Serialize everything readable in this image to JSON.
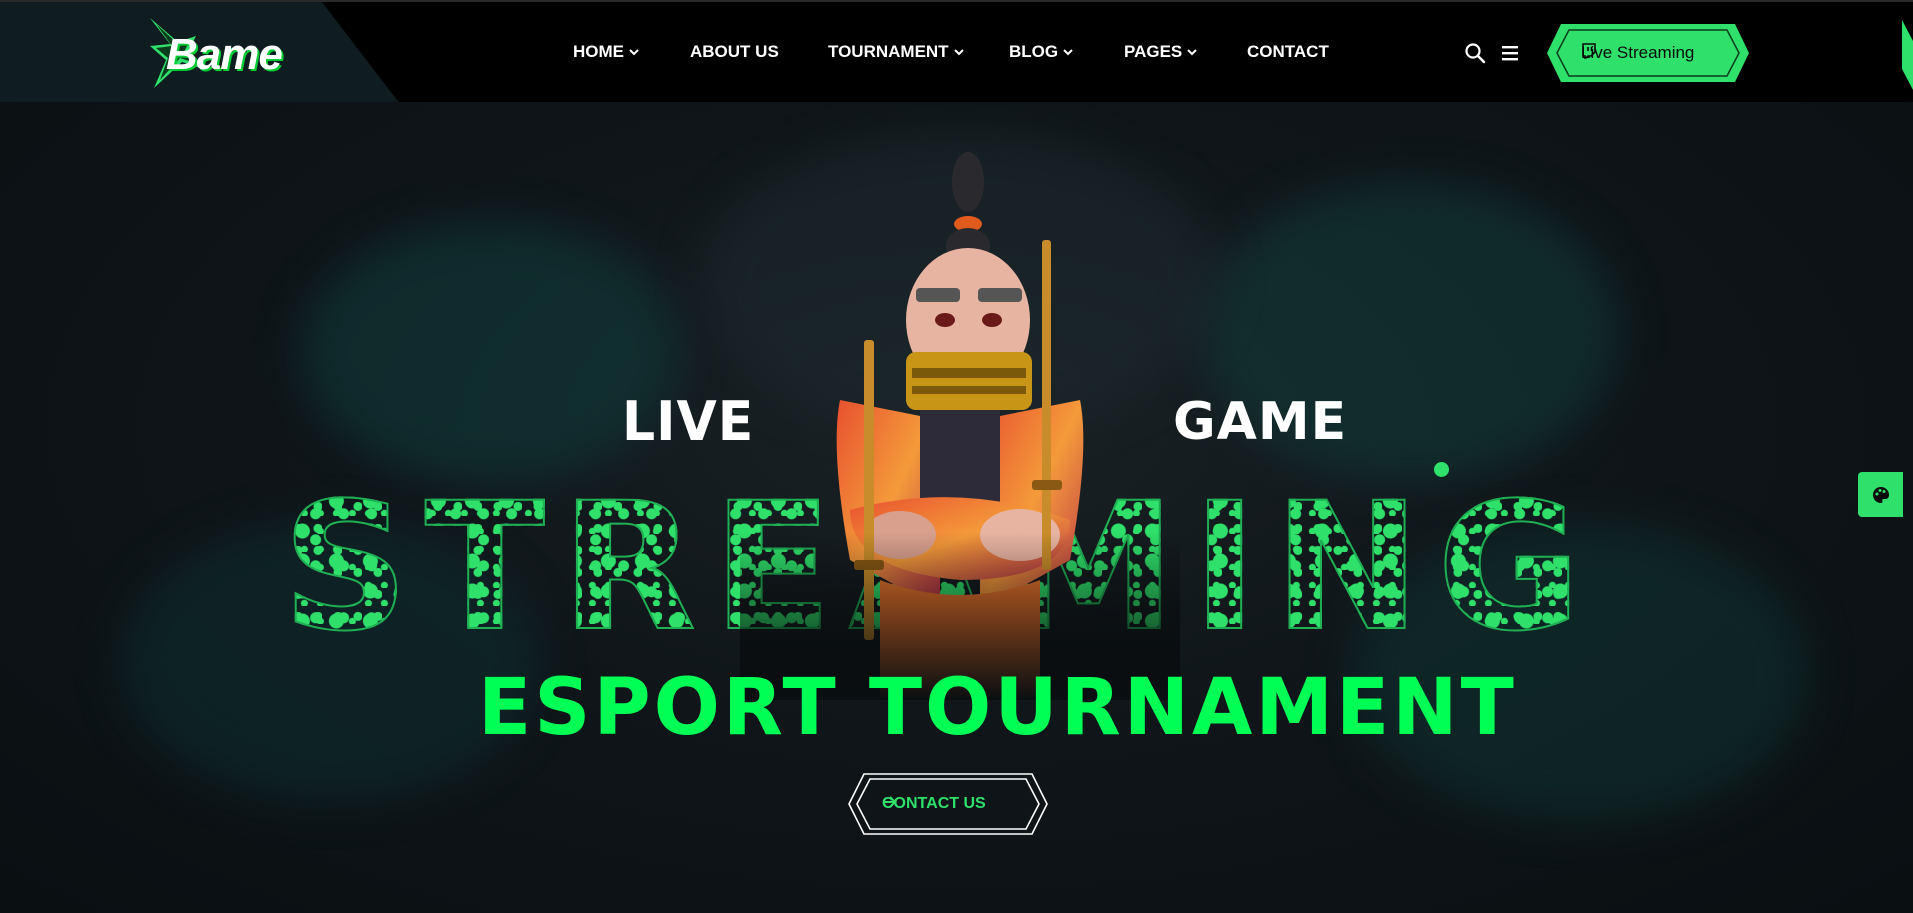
{
  "brand": {
    "logo_text": "Bame",
    "accent": "#2fe06a",
    "headline_green": "#00ff55"
  },
  "nav": {
    "items": [
      {
        "label": "HOME",
        "has_dropdown": true
      },
      {
        "label": "ABOUT US",
        "has_dropdown": false
      },
      {
        "label": "TOURNAMENT",
        "has_dropdown": true
      },
      {
        "label": "BLOG",
        "has_dropdown": true
      },
      {
        "label": "PAGES",
        "has_dropdown": true
      },
      {
        "label": "CONTACT",
        "has_dropdown": false
      }
    ]
  },
  "header_actions": {
    "search_icon": "search-icon",
    "menu_icon": "hamburger-icon",
    "live_button_label": "Live Streaming",
    "live_button_icon": "twitch-icon"
  },
  "hero": {
    "top_left_word": "LIVE",
    "top_right_word": "GAME",
    "big_word": "STREAMING",
    "headline": "ESPORT TOURNAMENT",
    "cta_label": "CONTACT US",
    "cta_icon": "arrow-right-icon"
  },
  "side_tools": {
    "palette_icon": "palette-icon"
  }
}
